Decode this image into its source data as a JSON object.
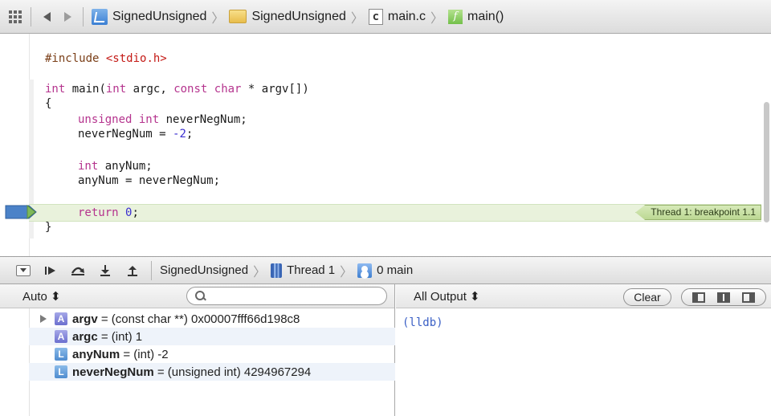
{
  "jump_bar": {
    "project": "SignedUnsigned",
    "group": "SignedUnsigned",
    "file": "main.c",
    "file_icon_letter": "c",
    "function": "main()",
    "function_icon_letter": "f",
    "chevron": "〉"
  },
  "editor": {
    "include_directive": "#include",
    "include_header": "<stdio.h>",
    "lines": {
      "main_kw1": "int",
      "main_rest1": " main(",
      "main_kw2": "int",
      "main_rest2": " argc, ",
      "main_kw3": "const char",
      "main_rest3": " * argv[])",
      "open_brace": "{",
      "decl_kw": "unsigned int",
      "decl_rest": " neverNegNum;",
      "assign1_left": "neverNegNum = ",
      "assign1_num": "-2",
      "assign1_end": ";",
      "decl2_kw": "int",
      "decl2_rest": " anyNum;",
      "assign2": "anyNum = neverNegNum;",
      "return_kw": "return",
      "return_num": "0",
      "return_end": ";",
      "close_brace": "}"
    },
    "thread_badge": "Thread 1: breakpoint 1.1"
  },
  "debug_bar": {
    "process": "SignedUnsigned",
    "thread": "Thread 1",
    "frame": "0 main",
    "chevron": "〉"
  },
  "variables": {
    "scope": "Auto ⬍",
    "items": [
      {
        "badge": "A",
        "name": "argv",
        "value": " = (const char **) 0x00007fff66d198c8"
      },
      {
        "badge": "A",
        "name": "argc",
        "value": " = (int) 1"
      },
      {
        "badge": "L",
        "name": "anyNum",
        "value": " = (int) -2"
      },
      {
        "badge": "L",
        "name": "neverNegNum",
        "value": " = (unsigned int) 4294967294"
      }
    ]
  },
  "console": {
    "filter": "All Output ⬍",
    "clear_label": "Clear",
    "output": "(lldb)"
  },
  "colors": {
    "keyword": "#b5348e",
    "number": "#3a2ed0",
    "current_line": "#e9f2dc",
    "console_text": "#3a5fc5"
  }
}
